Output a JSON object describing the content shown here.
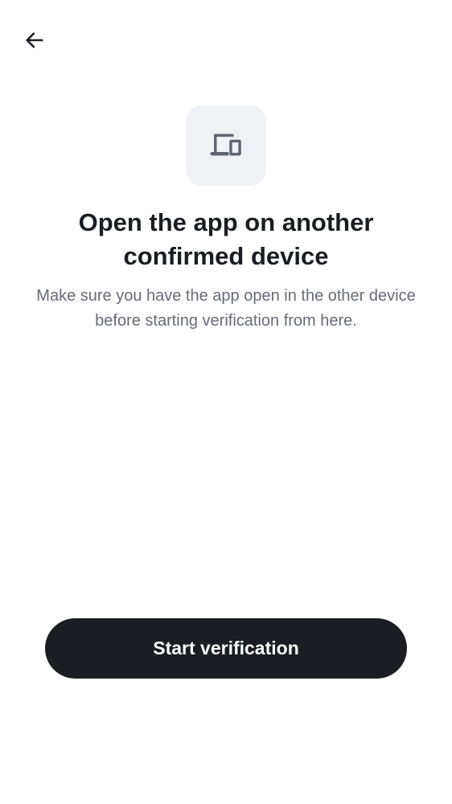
{
  "header": {
    "back_icon": "arrow-left-icon"
  },
  "hero": {
    "icon": "devices-icon",
    "title": "Open the app on another confirmed device",
    "subtitle": "Make sure you have the app open in the other device before starting verification from here."
  },
  "actions": {
    "start_label": "Start verification"
  },
  "colors": {
    "primary": "#1b1d22",
    "icon_tile_bg": "#f0f2f5",
    "secondary_text": "#656d77"
  }
}
